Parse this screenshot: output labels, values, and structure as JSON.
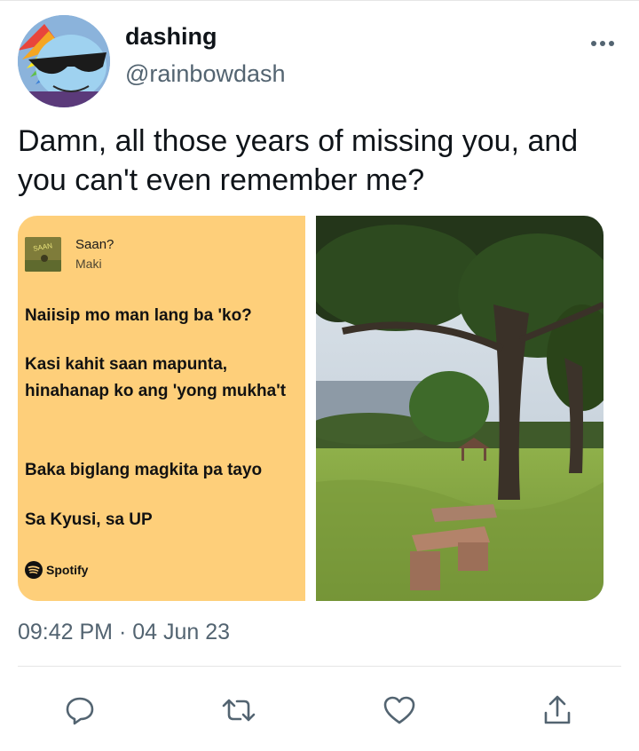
{
  "user": {
    "display_name": "dashing",
    "handle": "@rainbowdash",
    "avatar_icon": "avatar-rainbow-dash-sunglasses"
  },
  "tweet": {
    "text": "Damn, all those years of missing you, and you can't even remember me?",
    "timestamp": "09:42 PM · 04 Jun 23"
  },
  "lyric_card": {
    "song_title": "Saan?",
    "artist": "Maki",
    "lines": [
      "Naiisip mo man lang ba 'ko?",
      "Kasi kahit saan mapunta, hinahanap ko ang 'yong mukha't",
      "Baka biglang magkita pa tayo",
      "Sa Kyusi, sa UP"
    ],
    "brand": "Spotify",
    "background_color": "#fecf7a"
  },
  "actions": {
    "reply_icon": "reply-icon",
    "retweet_icon": "retweet-icon",
    "like_icon": "like-icon",
    "share_icon": "share-icon",
    "more_icon": "more-icon"
  },
  "colors": {
    "text_primary": "#0f1419",
    "text_secondary": "#536471"
  }
}
